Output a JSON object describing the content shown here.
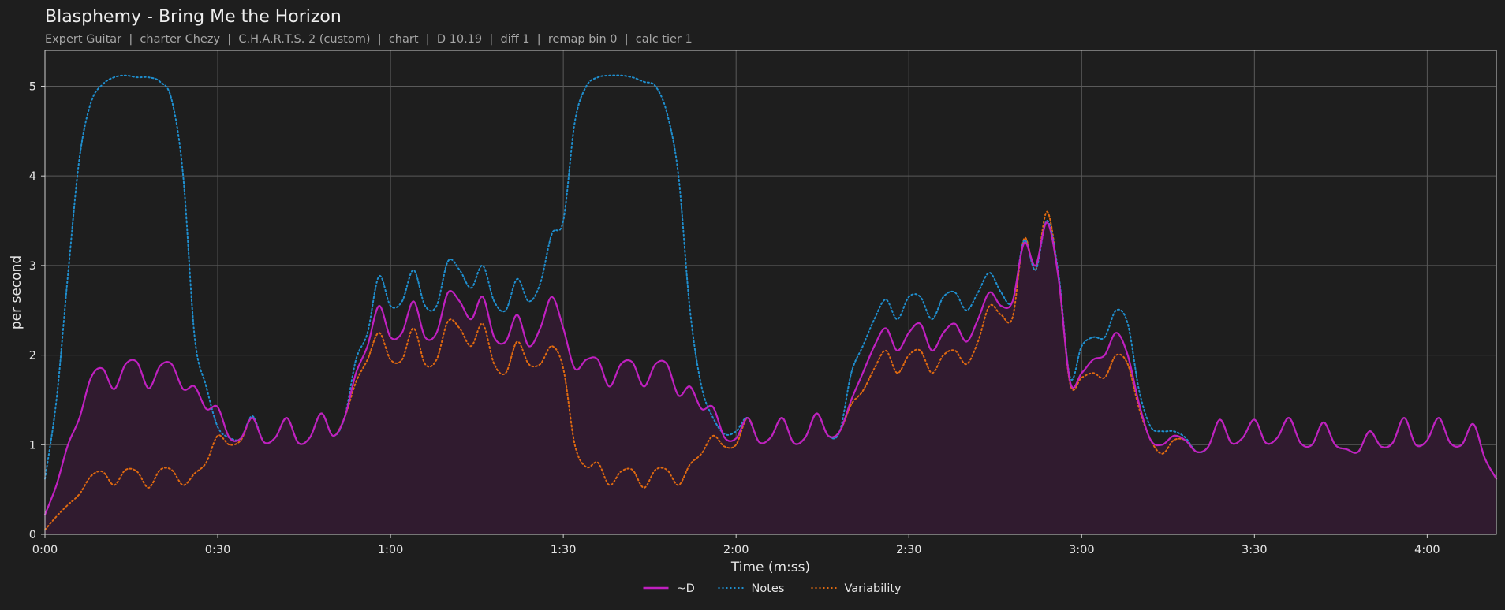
{
  "chart_data": {
    "type": "line",
    "title": "Blasphemy - Bring Me the Horizon",
    "subtitle": "Expert Guitar  |  charter Chezy  |  C.H.A.R.T.S. 2 (custom)  |  chart  |  D 10.19  |  diff 1  |  remap bin 0  |  calc tier 1",
    "xlabel": "Time (m:ss)",
    "ylabel": "per second",
    "xlim": [
      0,
      252
    ],
    "ylim": [
      0,
      5.4
    ],
    "x_ticks": [
      0,
      30,
      60,
      90,
      120,
      150,
      180,
      210,
      240
    ],
    "x_tick_labels": [
      "0:00",
      "0:30",
      "1:00",
      "1:30",
      "2:00",
      "2:30",
      "3:00",
      "3:30",
      "4:00"
    ],
    "y_ticks": [
      0,
      1,
      2,
      3,
      4,
      5
    ],
    "y_tick_labels": [
      "0",
      "1",
      "2",
      "3",
      "4",
      "5"
    ],
    "grid": true,
    "legend_position": "bottom-center",
    "x": [
      0,
      2,
      4,
      6,
      8,
      10,
      12,
      14,
      16,
      18,
      20,
      22,
      24,
      26,
      28,
      30,
      32,
      34,
      36,
      38,
      40,
      42,
      44,
      46,
      48,
      50,
      52,
      54,
      56,
      58,
      60,
      62,
      64,
      66,
      68,
      70,
      72,
      74,
      76,
      78,
      80,
      82,
      84,
      86,
      88,
      90,
      92,
      94,
      96,
      98,
      100,
      102,
      104,
      106,
      108,
      110,
      112,
      114,
      116,
      118,
      120,
      122,
      124,
      126,
      128,
      130,
      132,
      134,
      136,
      138,
      140,
      142,
      144,
      146,
      148,
      150,
      152,
      154,
      156,
      158,
      160,
      162,
      164,
      166,
      168,
      170,
      172,
      174,
      176,
      178,
      180,
      182,
      184,
      186,
      188,
      190,
      192,
      194,
      196,
      198,
      200,
      202,
      204,
      206,
      208,
      210,
      212,
      214,
      216,
      218,
      220,
      222,
      224,
      226,
      228,
      230,
      232,
      234,
      236,
      238,
      240,
      242,
      244,
      246,
      248,
      250,
      252
    ],
    "series": [
      {
        "name": "~D",
        "color": "#c020c0",
        "style": "solid",
        "values": [
          0.22,
          0.55,
          1.0,
          1.3,
          1.75,
          1.85,
          1.62,
          1.9,
          1.92,
          1.63,
          1.88,
          1.9,
          1.62,
          1.65,
          1.4,
          1.42,
          1.08,
          1.07,
          1.3,
          1.03,
          1.08,
          1.3,
          1.02,
          1.08,
          1.35,
          1.1,
          1.3,
          1.8,
          2.1,
          2.55,
          2.2,
          2.25,
          2.6,
          2.2,
          2.25,
          2.7,
          2.6,
          2.4,
          2.65,
          2.2,
          2.15,
          2.45,
          2.1,
          2.3,
          2.65,
          2.3,
          1.85,
          1.95,
          1.95,
          1.65,
          1.9,
          1.92,
          1.65,
          1.9,
          1.9,
          1.55,
          1.65,
          1.4,
          1.42,
          1.08,
          1.07,
          1.3,
          1.03,
          1.08,
          1.3,
          1.02,
          1.08,
          1.35,
          1.1,
          1.15,
          1.5,
          1.8,
          2.1,
          2.3,
          2.05,
          2.25,
          2.35,
          2.05,
          2.25,
          2.35,
          2.15,
          2.4,
          2.7,
          2.55,
          2.6,
          3.25,
          3.0,
          3.48,
          2.85,
          1.7,
          1.8,
          1.95,
          2.0,
          2.25,
          2.0,
          1.45,
          1.05,
          1.0,
          1.1,
          1.05,
          0.92,
          0.98,
          1.28,
          1.02,
          1.08,
          1.28,
          1.02,
          1.08,
          1.3,
          1.02,
          1.0,
          1.25,
          1.0,
          0.95,
          0.92,
          1.15,
          0.98,
          1.02,
          1.3,
          1.0,
          1.05,
          1.3,
          1.02,
          1.0,
          1.23,
          0.85,
          0.62,
          0.1
        ]
      },
      {
        "name": "Notes",
        "color": "#1f8fcf",
        "style": "dotted",
        "values": [
          0.62,
          1.5,
          2.9,
          4.2,
          4.82,
          5.02,
          5.1,
          5.12,
          5.1,
          5.1,
          5.05,
          4.85,
          4.0,
          2.2,
          1.65,
          1.2,
          1.08,
          1.07,
          1.32,
          1.03,
          1.08,
          1.3,
          1.02,
          1.08,
          1.35,
          1.1,
          1.3,
          1.95,
          2.25,
          2.88,
          2.55,
          2.6,
          2.95,
          2.55,
          2.55,
          3.05,
          2.95,
          2.75,
          3.0,
          2.6,
          2.5,
          2.85,
          2.6,
          2.8,
          3.35,
          3.5,
          4.6,
          5.0,
          5.1,
          5.12,
          5.12,
          5.1,
          5.05,
          5.0,
          4.7,
          4.0,
          2.5,
          1.65,
          1.3,
          1.12,
          1.15,
          1.3,
          1.03,
          1.08,
          1.3,
          1.02,
          1.08,
          1.35,
          1.1,
          1.15,
          1.8,
          2.1,
          2.4,
          2.62,
          2.4,
          2.65,
          2.65,
          2.4,
          2.65,
          2.7,
          2.5,
          2.7,
          2.92,
          2.7,
          2.6,
          3.28,
          2.95,
          3.5,
          2.9,
          1.75,
          2.1,
          2.2,
          2.2,
          2.5,
          2.35,
          1.6,
          1.2,
          1.15,
          1.15,
          1.08,
          0.92,
          0.98,
          1.28,
          1.02,
          1.08,
          1.28,
          1.02,
          1.08,
          1.3,
          1.02,
          1.0,
          1.25,
          1.0,
          0.95,
          0.92,
          1.15,
          0.98,
          1.02,
          1.3,
          1.0,
          1.05,
          1.3,
          1.02,
          1.0,
          1.23,
          0.85,
          0.62,
          0.1
        ]
      },
      {
        "name": "Variability",
        "color": "#e06a10",
        "style": "dotted",
        "values": [
          0.05,
          0.2,
          0.33,
          0.45,
          0.65,
          0.7,
          0.55,
          0.72,
          0.7,
          0.52,
          0.72,
          0.72,
          0.55,
          0.68,
          0.8,
          1.1,
          1.0,
          1.05,
          1.3,
          1.03,
          1.08,
          1.3,
          1.02,
          1.08,
          1.35,
          1.1,
          1.3,
          1.7,
          1.95,
          2.25,
          1.95,
          1.95,
          2.3,
          1.9,
          1.95,
          2.38,
          2.3,
          2.1,
          2.35,
          1.9,
          1.8,
          2.15,
          1.9,
          1.9,
          2.1,
          1.85,
          1.0,
          0.75,
          0.8,
          0.55,
          0.7,
          0.72,
          0.52,
          0.72,
          0.72,
          0.55,
          0.78,
          0.9,
          1.1,
          0.98,
          1.0,
          1.3,
          1.03,
          1.08,
          1.3,
          1.02,
          1.08,
          1.35,
          1.1,
          1.15,
          1.45,
          1.6,
          1.85,
          2.05,
          1.8,
          2.0,
          2.05,
          1.8,
          2.0,
          2.05,
          1.9,
          2.15,
          2.55,
          2.45,
          2.42,
          3.3,
          2.95,
          3.6,
          2.85,
          1.68,
          1.75,
          1.8,
          1.75,
          2.0,
          1.9,
          1.4,
          1.05,
          0.9,
          1.05,
          1.05,
          0.92,
          0.98,
          1.28,
          1.02,
          1.08,
          1.28,
          1.02,
          1.08,
          1.3,
          1.02,
          1.0,
          1.25,
          1.0,
          0.95,
          0.92,
          1.15,
          0.98,
          1.02,
          1.3,
          1.0,
          1.05,
          1.3,
          1.02,
          1.0,
          1.23,
          0.85,
          0.62,
          0.1
        ]
      }
    ],
    "fill_under": "~D",
    "fill_color": "#301b2f"
  }
}
